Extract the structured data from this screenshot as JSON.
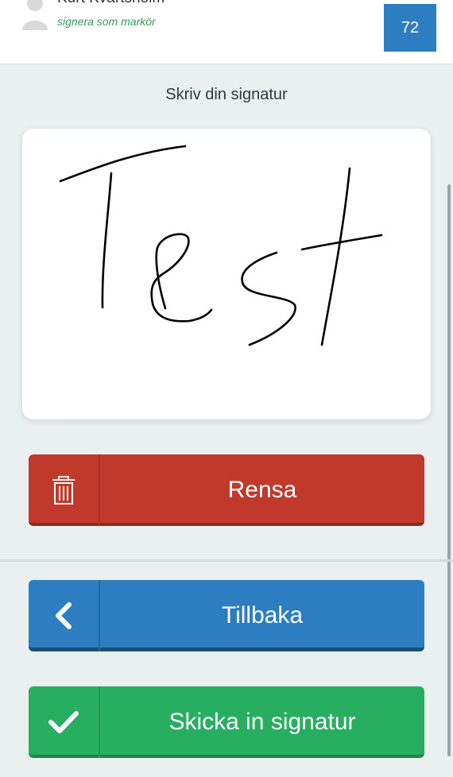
{
  "header": {
    "user_name": "Kurt Kvartsholm",
    "user_role": "signera som markör",
    "badge_count": "72"
  },
  "signature": {
    "heading": "Skriv din signatur",
    "drawn_text": "Test"
  },
  "buttons": {
    "clear_label": "Rensa",
    "back_label": "Tillbaka",
    "submit_label": "Skicka in signatur"
  },
  "icons": {
    "clear": "trash-icon",
    "back": "chevron-left-icon",
    "submit": "checkmark-icon",
    "avatar": "user-silhouette-icon"
  },
  "colors": {
    "clear": "#c0392b",
    "back": "#2c7ec0",
    "submit": "#27ae60",
    "badge": "#2c7ec0",
    "role_text": "#3d9a55"
  }
}
